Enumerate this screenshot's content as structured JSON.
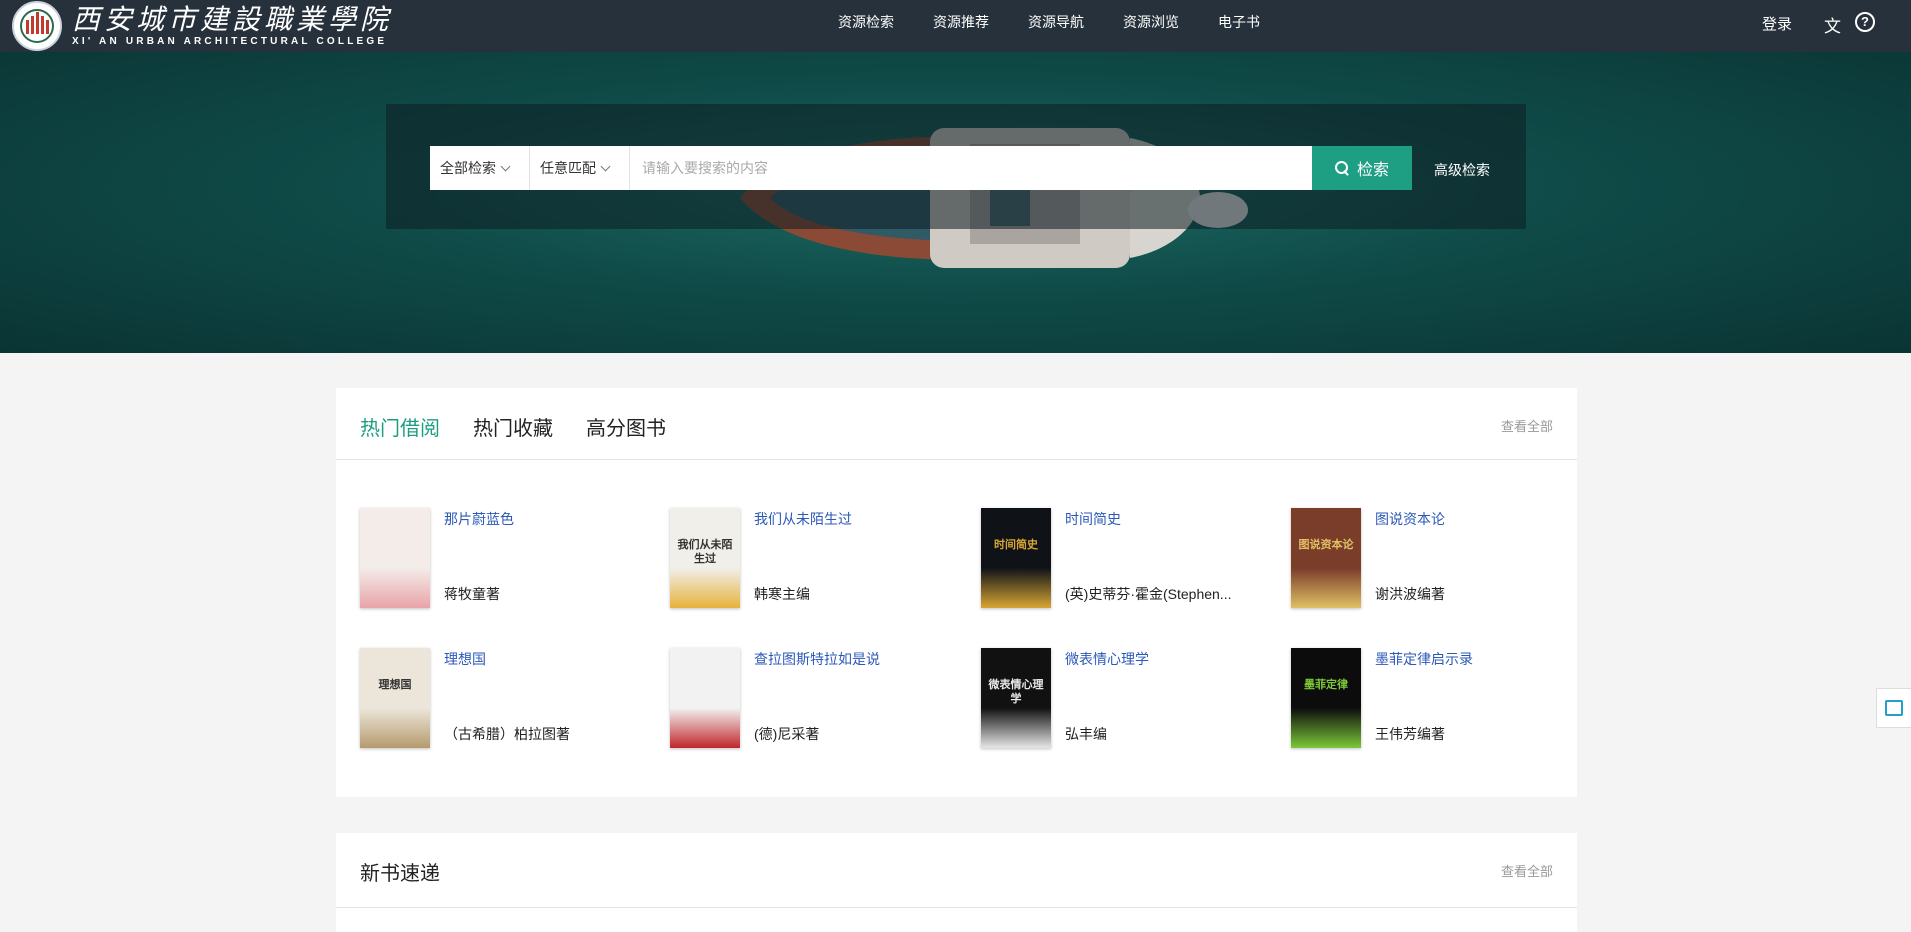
{
  "header": {
    "logo_cn": "西安城市建設職業學院",
    "logo_en": "XI' AN URBAN ARCHITECTURAL COLLEGE",
    "nav": [
      "资源检索",
      "资源推荐",
      "资源导航",
      "资源浏览",
      "电子书"
    ],
    "login": "登录",
    "lang_icon": "文",
    "help_icon": "?"
  },
  "search": {
    "scope": "全部检索",
    "match": "任意匹配",
    "placeholder": "请输入要搜索的内容",
    "button": "检索",
    "advanced": "高级检索"
  },
  "hot_section": {
    "tabs": [
      "热门借阅",
      "热门收藏",
      "高分图书"
    ],
    "view_all": "查看全部",
    "books": [
      {
        "title": "那片蔚蓝色",
        "author": "蒋牧童著",
        "cover_bg": "#f3ece8",
        "cover_accent": "#e8a3a9",
        "cover_text": ""
      },
      {
        "title": "我们从未陌生过",
        "author": "韩寒主编",
        "cover_bg": "#f1efea",
        "cover_accent": "#e7b23c",
        "cover_text": "我们从未陌生过"
      },
      {
        "title": "时间简史",
        "author": "(英)史蒂芬·霍金(Stephen...",
        "cover_bg": "#0f1318",
        "cover_accent": "#d7a634",
        "cover_text": "时间简史"
      },
      {
        "title": "图说资本论",
        "author": "谢洪波编著",
        "cover_bg": "#7a3d2a",
        "cover_accent": "#e0c064",
        "cover_text": "图说资本论"
      },
      {
        "title": "理想国",
        "author": "（古希腊）柏拉图著",
        "cover_bg": "#ece6da",
        "cover_accent": "#b59a6d",
        "cover_text": "理想国"
      },
      {
        "title": "查拉图斯特拉如是说",
        "author": "(德)尼采著",
        "cover_bg": "#f2f2f2",
        "cover_accent": "#c0262c",
        "cover_text": ""
      },
      {
        "title": "微表情心理学",
        "author": "弘丰编",
        "cover_bg": "#111111",
        "cover_accent": "#e6e6e6",
        "cover_text": "微表情心理学"
      },
      {
        "title": "墨菲定律启示录",
        "author": "王伟芳编著",
        "cover_bg": "#0c0c0c",
        "cover_accent": "#7cc83a",
        "cover_text": "墨菲定律"
      }
    ]
  },
  "new_section": {
    "title": "新书速递",
    "view_all": "查看全部"
  },
  "colors": {
    "header_bg": "#26313b",
    "accent": "#1e9e82",
    "link": "#2c59b8"
  }
}
